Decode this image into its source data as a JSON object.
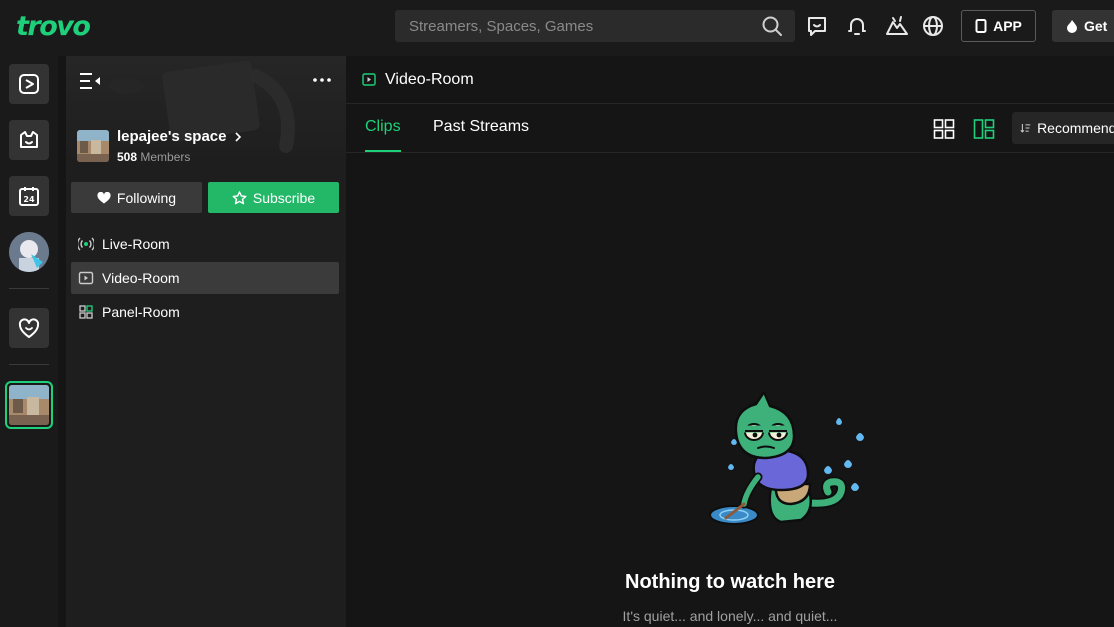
{
  "brand": {
    "logo_text": "trovo",
    "accent": "#1fd07a"
  },
  "topbar": {
    "search_placeholder": "Streamers, Spaces, Games",
    "app_label": "APP",
    "get_label": "Get"
  },
  "space": {
    "name": "lepajee's space",
    "member_count": "508",
    "member_label": "Members",
    "following_label": "Following",
    "subscribe_label": "Subscribe",
    "rooms": [
      {
        "label": "Live-Room",
        "icon": "live-icon",
        "active": false
      },
      {
        "label": "Video-Room",
        "icon": "video-icon",
        "active": true
      },
      {
        "label": "Panel-Room",
        "icon": "panel-icon",
        "active": false
      }
    ]
  },
  "main": {
    "room_title": "Video-Room",
    "tabs": [
      {
        "label": "Clips",
        "active": true
      },
      {
        "label": "Past Streams",
        "active": false
      }
    ],
    "sort_label": "Recommended",
    "empty_title": "Nothing to watch here",
    "empty_subtitle": "It's quiet... and lonely... and quiet..."
  }
}
